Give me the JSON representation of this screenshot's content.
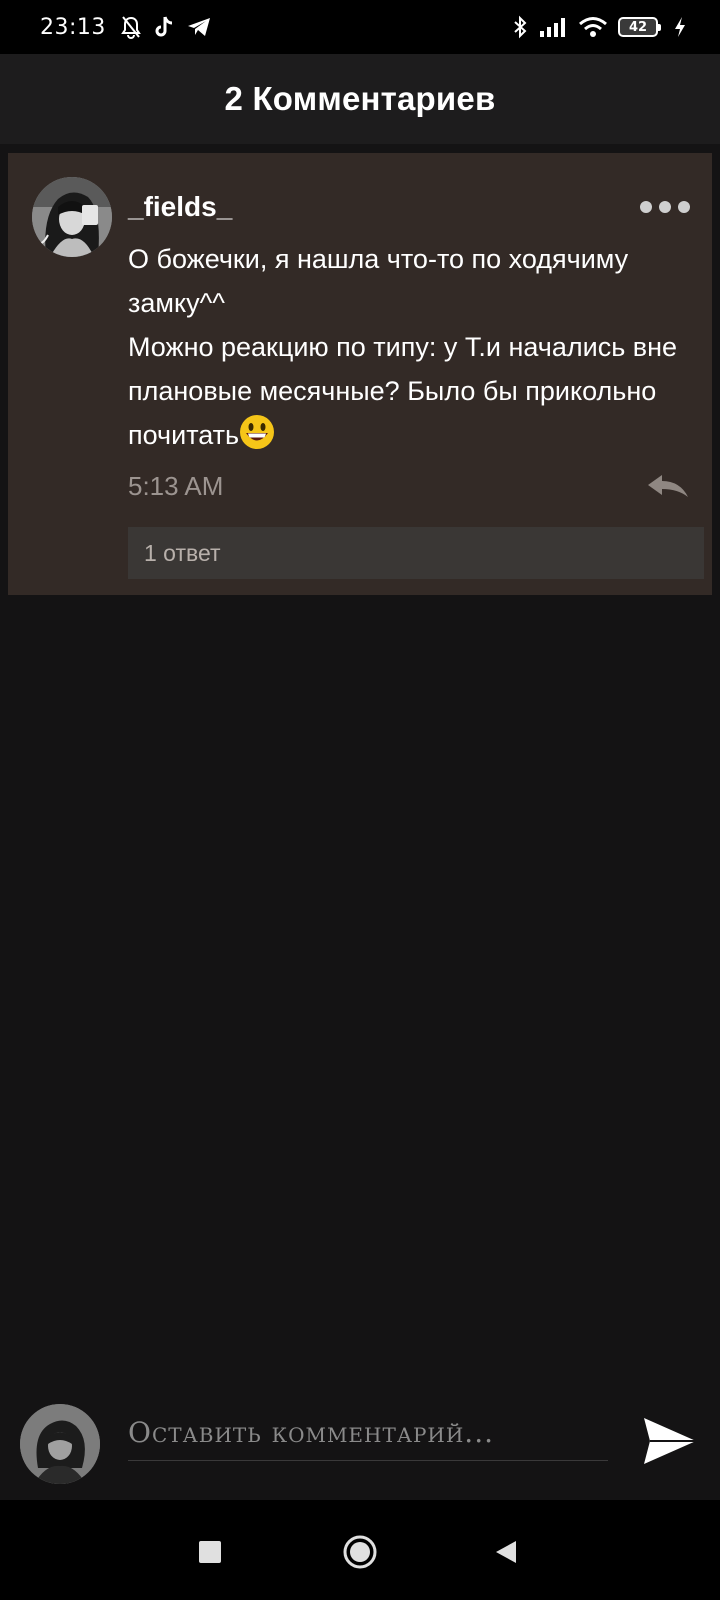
{
  "status_bar": {
    "time": "23:13",
    "left_icons": [
      "muted-bell-icon",
      "tiktok-icon",
      "telegram-icon"
    ],
    "right_icons": [
      "bluetooth-icon",
      "signal-icon",
      "wifi-icon",
      "battery-icon",
      "charging-icon"
    ],
    "battery_level": "42"
  },
  "header": {
    "title": "2 Комментариев"
  },
  "comment": {
    "username": "_fields_",
    "text": "О божечки, я нашла что-то по ходячиму замку^^\nМожно реакцию по типу: у Т.и начались вне плановые месячные? Было бы прикольно почитать",
    "emoji": "grinning-face-emoji",
    "time": "5:13 AM",
    "replies_label": "1 ответ"
  },
  "input": {
    "placeholder": "Оставить комментарий..."
  },
  "nav": {
    "icons": [
      "recents-square-icon",
      "home-circle-icon",
      "back-triangle-icon"
    ]
  },
  "colors": {
    "background": "#141314",
    "header_bg": "#1d1c1d",
    "card_bg": "#332a26",
    "replies_bg": "#3a3735",
    "muted_text": "#9c9490"
  }
}
